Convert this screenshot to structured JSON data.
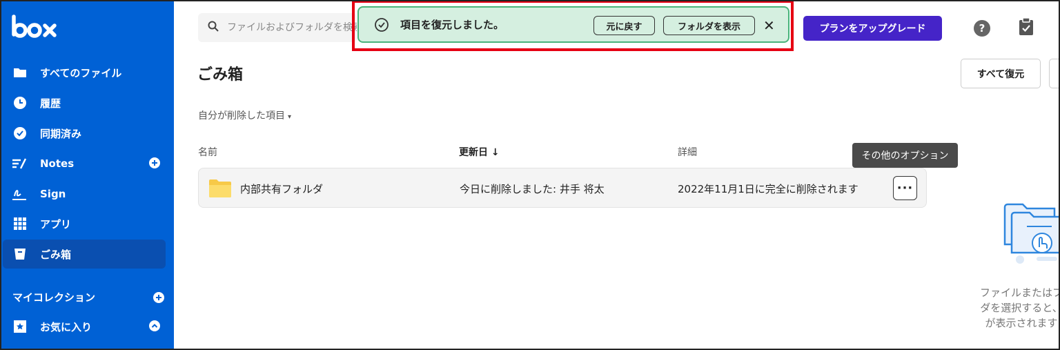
{
  "sidebar": {
    "items": [
      {
        "label": "すべてのファイル",
        "icon": "folder-icon"
      },
      {
        "label": "履歴",
        "icon": "clock-icon"
      },
      {
        "label": "同期済み",
        "icon": "check-circle-icon"
      },
      {
        "label": "Notes",
        "icon": "notes-icon"
      },
      {
        "label": "Sign",
        "icon": "sign-icon"
      },
      {
        "label": "アプリ",
        "icon": "apps-grid-icon"
      },
      {
        "label": "ごみ箱",
        "icon": "trash-icon"
      }
    ],
    "collections_label": "マイコレクション",
    "favorites_label": "お気に入り"
  },
  "header": {
    "search_placeholder": "ファイルおよびフォルダを検索",
    "upgrade_label": "プランをアップグレード",
    "help_label": "?"
  },
  "toast": {
    "message": "項目を復元しました。",
    "undo_label": "元に戻す",
    "show_folder_label": "フォルダを表示",
    "close_label": "✕"
  },
  "page": {
    "title": "ごみ箱",
    "restore_all_label": "すべて復元",
    "filter_label": "自分が削除した項目"
  },
  "table": {
    "columns": [
      "名前",
      "更新日",
      "詳細"
    ],
    "sort_indicator": "↓",
    "rows": [
      {
        "name": "内部共有フォルダ",
        "modified": "今日に削除しました: 井手 将太",
        "details": "2022年11月1日に完全に削除されます"
      }
    ],
    "more_options_tooltip": "その他のオプション"
  },
  "empty_state": {
    "line1": "ファイルまたはフ",
    "line2": "ダを選択すると、",
    "line3": "が表示されます"
  },
  "colors": {
    "sidebar_bg": "#0061d5",
    "upgrade_bg": "#4524c8",
    "toast_bg": "#d5efe0",
    "highlight_border": "#e60012"
  }
}
